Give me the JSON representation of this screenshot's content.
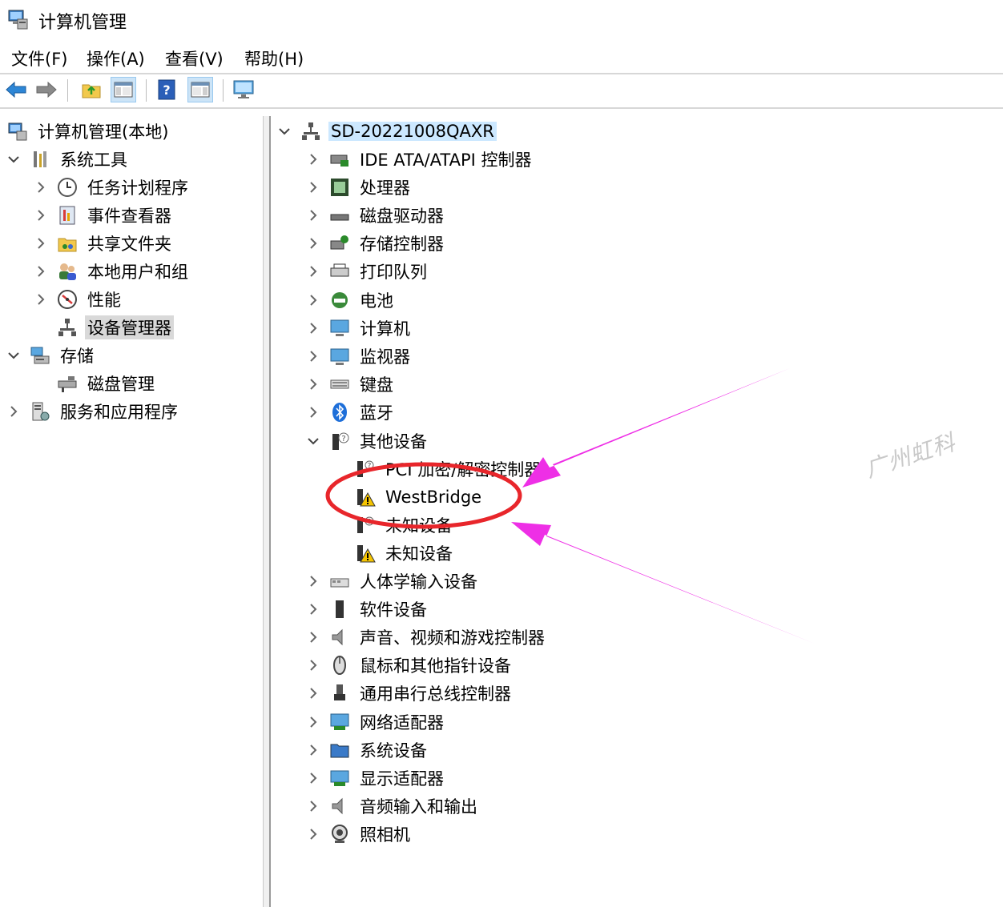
{
  "window": {
    "title": "计算机管理"
  },
  "menu": [
    "文件(F)",
    "操作(A)",
    "查看(V)",
    "帮助(H)"
  ],
  "toolbar": {
    "buttons": [
      "back-arrow-icon",
      "forward-arrow-icon",
      "up-folder-icon",
      "show-hide-tree-icon",
      "help-icon",
      "properties-pane-icon",
      "monitor-icon"
    ],
    "pressed": [
      "show-hide-tree-icon",
      "properties-pane-icon"
    ]
  },
  "left_tree": {
    "root": "计算机管理(本地)",
    "system_tools": "系统工具",
    "task_scheduler": "任务计划程序",
    "event_viewer": "事件查看器",
    "shared_folders": "共享文件夹",
    "local_users": "本地用户和组",
    "performance": "性能",
    "device_manager": "设备管理器",
    "storage": "存储",
    "disk_management": "磁盘管理",
    "services_apps": "服务和应用程序"
  },
  "device_tree": {
    "computer_name": "SD-20221008QAXR",
    "categories_top": [
      "IDE ATA/ATAPI 控制器",
      "处理器",
      "磁盘驱动器",
      "存储控制器",
      "打印队列",
      "电池",
      "计算机",
      "监视器",
      "键盘",
      "蓝牙"
    ],
    "other_devices": {
      "label": "其他设备",
      "children": [
        "PCI 加密/解密控制器",
        "WestBridge",
        "未知设备",
        "未知设备"
      ]
    },
    "categories_bottom": [
      "人体学输入设备",
      "软件设备",
      "声音、视频和游戏控制器",
      "鼠标和其他指针设备",
      "通用串行总线控制器",
      "网络适配器",
      "系统设备",
      "显示适配器",
      "音频输入和输出",
      "照相机"
    ]
  },
  "annotation": {
    "watermark": "广州虹科",
    "ellipse_color": "#e8262b",
    "arrow_color": "#ee2fe6"
  }
}
